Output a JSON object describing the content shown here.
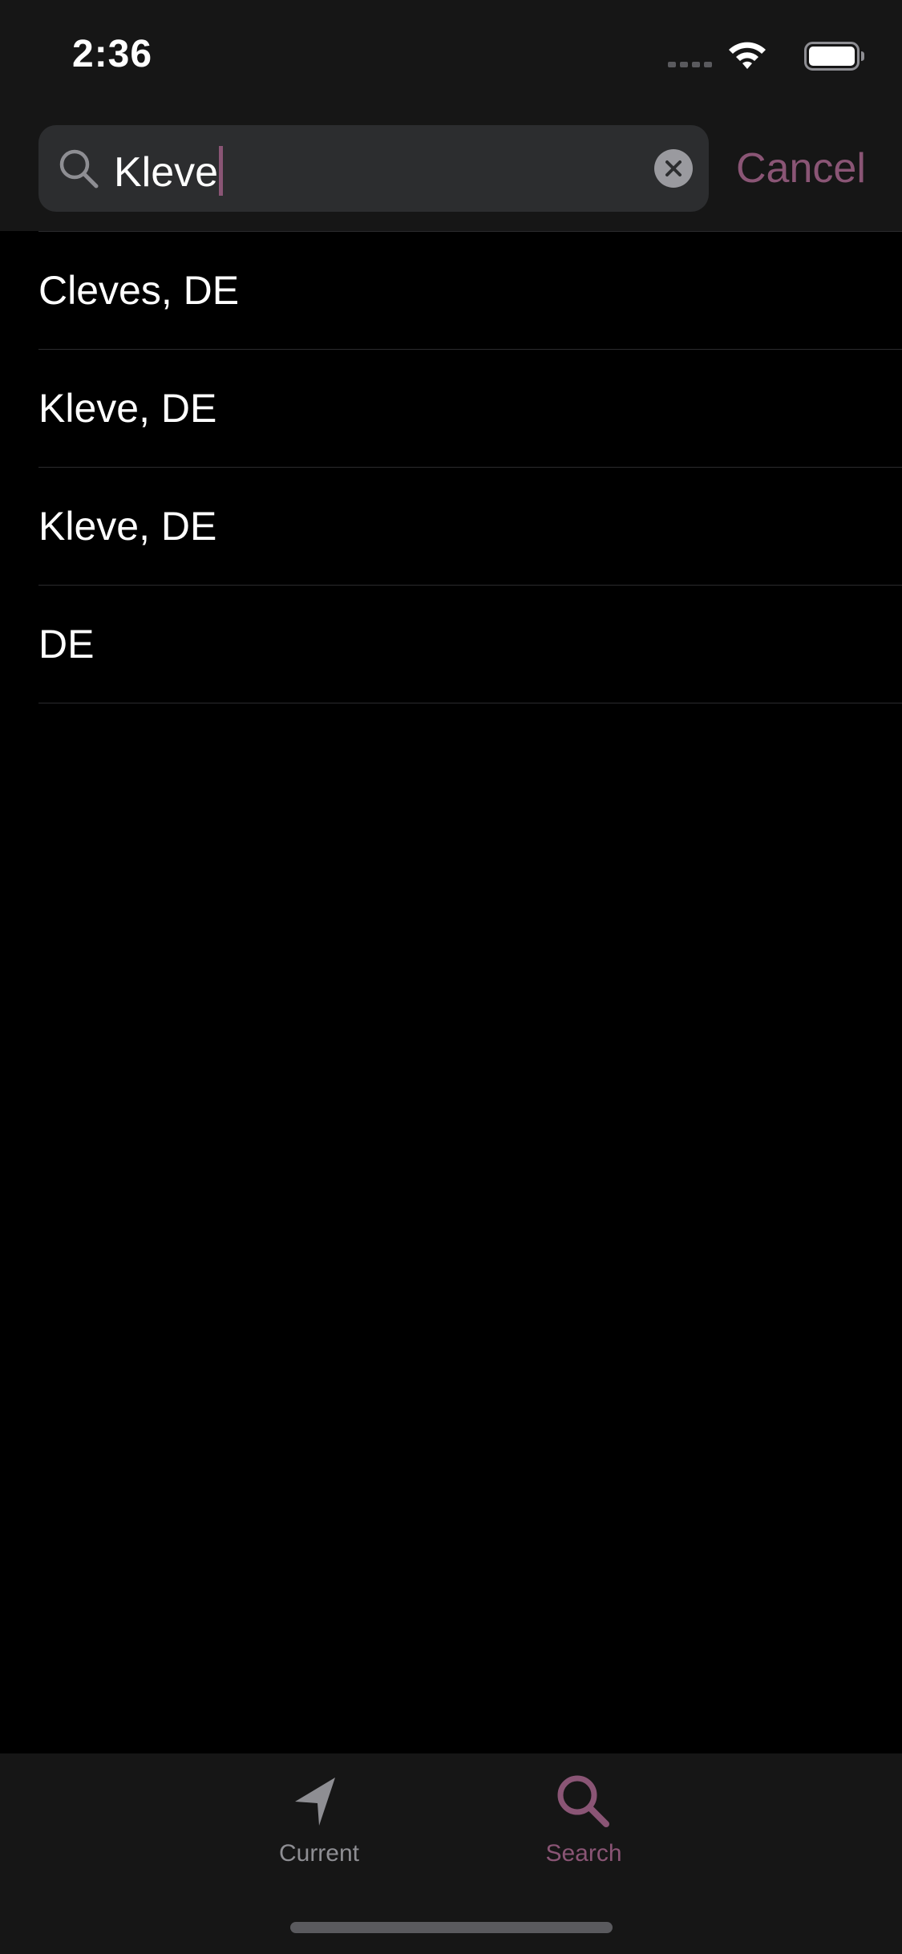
{
  "status_bar": {
    "time": "2:36",
    "icons": [
      "signal-icon",
      "wifi-icon",
      "battery-icon"
    ]
  },
  "search": {
    "value": "Kleve",
    "placeholder": "",
    "cancel_label": "Cancel"
  },
  "results": [
    {
      "label": "Cleves, DE"
    },
    {
      "label": "Kleve, DE"
    },
    {
      "label": "Kleve, DE"
    },
    {
      "label": "DE"
    }
  ],
  "tab_bar": {
    "tabs": [
      {
        "label": "Current",
        "icon": "location-arrow-icon",
        "selected": false
      },
      {
        "label": "Search",
        "icon": "search-icon",
        "selected": true
      }
    ]
  },
  "colors": {
    "accent": "#8a5575",
    "background": "#000000",
    "header_background": "#161616",
    "search_field_background": "#2c2d2f",
    "inactive_tab": "#8e8e93"
  }
}
